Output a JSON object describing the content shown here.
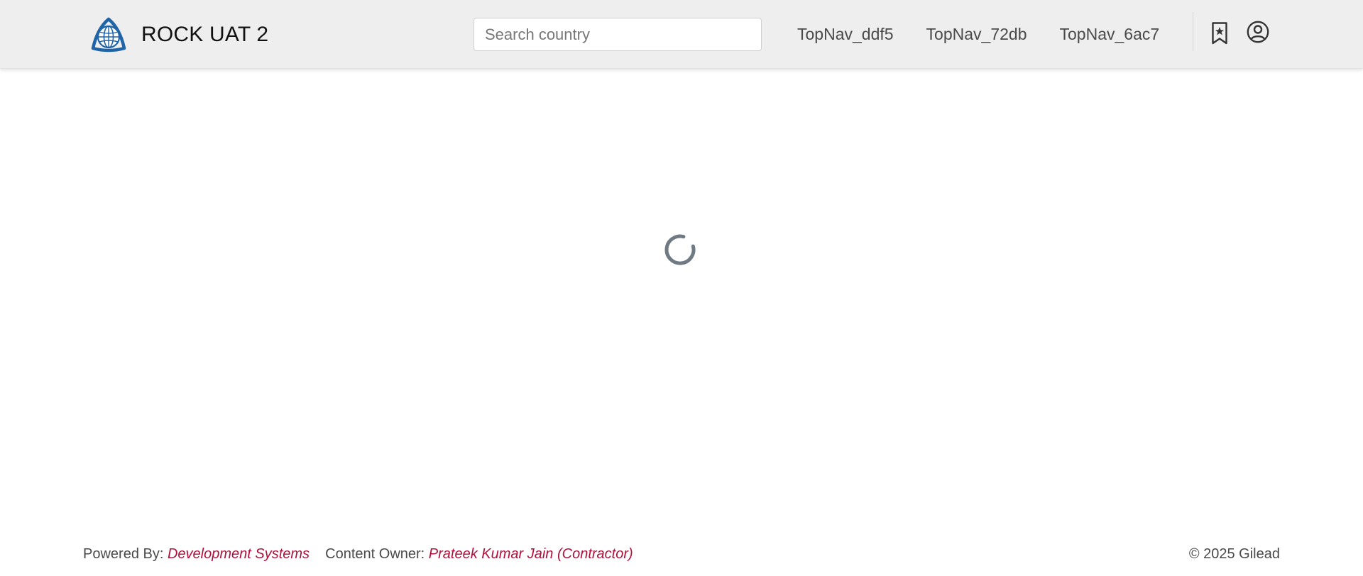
{
  "header": {
    "title": "ROCK UAT 2",
    "logo_icon": "globe-trinity-logo-icon",
    "search": {
      "placeholder": "Search country",
      "value": ""
    },
    "nav": [
      "TopNav_ddf5",
      "TopNav_72db",
      "TopNav_6ac7"
    ],
    "icons": {
      "bookmark": "bookmark-star-icon",
      "user": "user-circle-icon"
    }
  },
  "main": {
    "loading": true,
    "spinner_icon": "loading-spinner-icon"
  },
  "footer": {
    "powered_by_label": "Powered By:",
    "powered_by_value": "Development Systems",
    "owner_label": "Content Owner:",
    "owner_value": "Prateek Kumar Jain (Contractor)",
    "copyright": "© 2025 Gilead"
  },
  "colors": {
    "header_bg": "#eeeeee",
    "accent_link": "#b0103a",
    "logo_blue": "#1f63a8",
    "spinner": "#6f7a83"
  }
}
